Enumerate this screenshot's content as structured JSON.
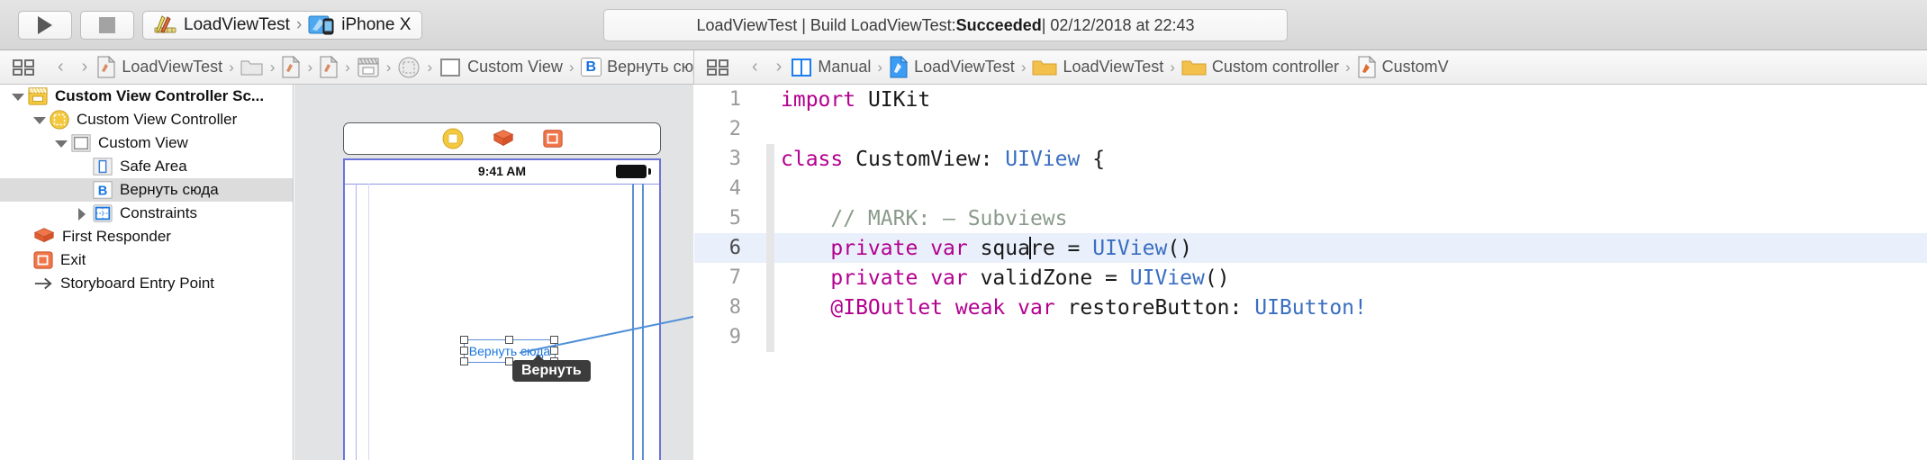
{
  "toolbar": {
    "run_button": "run-button",
    "stop_button": "stop-button",
    "scheme_target": "LoadViewTest",
    "scheme_separator": "›",
    "scheme_device": "iPhone X",
    "status_prefix": "LoadViewTest | Build LoadViewTest: ",
    "status_result": "Succeeded",
    "status_suffix": " | 02/12/2018 at 22:43"
  },
  "jumpbar_left": {
    "items": [
      {
        "icon": "storyboard-file-icon",
        "label": "LoadViewTest"
      },
      {
        "icon": "folder-icon",
        "label": ""
      },
      {
        "icon": "storyboard-file-icon",
        "label": ""
      },
      {
        "icon": "storyboard-file-icon",
        "label": ""
      },
      {
        "icon": "view-controller-scene-icon",
        "label": ""
      },
      {
        "icon": "view-controller-icon",
        "label": ""
      },
      {
        "icon": "view-icon",
        "label": "Custom View"
      },
      {
        "icon": "button-chip-icon",
        "label": "Вернуть сюда"
      }
    ],
    "chip_letter": "B"
  },
  "jumpbar_right": {
    "items": [
      {
        "icon": "assistant-manual-icon",
        "label": "Manual"
      },
      {
        "icon": "swift-project-icon",
        "label": "LoadViewTest"
      },
      {
        "icon": "folder-icon",
        "label": "LoadViewTest"
      },
      {
        "icon": "folder-icon",
        "label": "Custom controller"
      },
      {
        "icon": "swift-file-icon",
        "label": "CustomV"
      }
    ]
  },
  "outline": {
    "rows": [
      {
        "indent": 0,
        "triangle": "down",
        "icon": "scene-icon",
        "label": "Custom View Controller Sc...",
        "bold": true,
        "selected": false
      },
      {
        "indent": 1,
        "triangle": "down",
        "icon": "view-controller-icon",
        "label": "Custom View Controller",
        "bold": false,
        "selected": false
      },
      {
        "indent": 2,
        "triangle": "down",
        "icon": "view-icon",
        "label": "Custom View",
        "bold": false,
        "selected": false
      },
      {
        "indent": 3,
        "triangle": "none",
        "icon": "safe-area-icon",
        "label": "Safe Area",
        "bold": false,
        "selected": false
      },
      {
        "indent": 3,
        "triangle": "none",
        "icon": "button-icon",
        "label": "Вернуть сюда",
        "bold": false,
        "selected": true
      },
      {
        "indent": 2,
        "triangle": "right",
        "icon": "constraints-icon",
        "label": "Constraints",
        "bold": false,
        "selected": false
      },
      {
        "indent": 0,
        "triangle": "none",
        "icon": "first-responder-icon",
        "label": "First Responder",
        "bold": false,
        "selected": false
      },
      {
        "indent": 0,
        "triangle": "none",
        "icon": "exit-icon",
        "label": "Exit",
        "bold": false,
        "selected": false
      },
      {
        "indent": 0,
        "triangle": "none",
        "icon": "entry-point-arrow-icon",
        "label": "Storyboard Entry Point",
        "bold": false,
        "selected": false
      }
    ]
  },
  "canvas": {
    "ib_bar_icons": [
      "view-controller-round-icon",
      "first-responder-cube-icon",
      "exit-square-icon"
    ],
    "phone_status_time": "9:41 AM",
    "selected_button_title": "Вернуть сюда",
    "tooltip_text": "Вернуть"
  },
  "editor": {
    "lines": [
      {
        "num": "1",
        "tokens": [
          {
            "t": "kw",
            "v": "import"
          },
          {
            "t": "pln",
            "v": " UIKit"
          }
        ],
        "highlight": false,
        "fold": false
      },
      {
        "num": "2",
        "tokens": [],
        "highlight": false,
        "fold": false
      },
      {
        "num": "3",
        "tokens": [
          {
            "t": "kw",
            "v": "class"
          },
          {
            "t": "pln",
            "v": " CustomView: "
          },
          {
            "t": "typ",
            "v": "UIView"
          },
          {
            "t": "pln",
            "v": " {"
          }
        ],
        "highlight": false,
        "fold": true
      },
      {
        "num": "4",
        "tokens": [],
        "highlight": false,
        "fold": true
      },
      {
        "num": "5",
        "tokens": [
          {
            "t": "cmt",
            "v": "    // MARK: — Subviews"
          }
        ],
        "highlight": false,
        "fold": true
      },
      {
        "num": "6",
        "tokens": [
          {
            "t": "kw",
            "v": "    private"
          },
          {
            "t": "pln",
            "v": " "
          },
          {
            "t": "kw",
            "v": "var"
          },
          {
            "t": "pln",
            "v": " squa"
          },
          {
            "t": "cursor",
            "v": ""
          },
          {
            "t": "pln",
            "v": "re = "
          },
          {
            "t": "typ",
            "v": "UIView"
          },
          {
            "t": "pln",
            "v": "()"
          }
        ],
        "highlight": true,
        "fold": true
      },
      {
        "num": "7",
        "tokens": [
          {
            "t": "kw",
            "v": "    private"
          },
          {
            "t": "pln",
            "v": " "
          },
          {
            "t": "kw",
            "v": "var"
          },
          {
            "t": "pln",
            "v": " validZone = "
          },
          {
            "t": "typ",
            "v": "UIView"
          },
          {
            "t": "pln",
            "v": "()"
          }
        ],
        "highlight": false,
        "fold": true
      },
      {
        "num": "8",
        "tokens": [
          {
            "t": "kw",
            "v": "    @IBOutlet"
          },
          {
            "t": "pln",
            "v": " "
          },
          {
            "t": "kw",
            "v": "weak"
          },
          {
            "t": "pln",
            "v": " "
          },
          {
            "t": "kw",
            "v": "var"
          },
          {
            "t": "pln",
            "v": " restoreButton: "
          },
          {
            "t": "typ",
            "v": "UIButton!"
          }
        ],
        "highlight": false,
        "fold": true
      },
      {
        "num": "9",
        "tokens": [],
        "highlight": false,
        "fold": true
      }
    ]
  },
  "colors": {
    "keyword": "#b3008f",
    "type": "#3a6ec0",
    "comment": "#8b9b8b",
    "selection": "#dcdcdc",
    "highlight_line": "#e9f0fb",
    "guide_purple": "#6b73d8",
    "guide_blue": "#5c8fd6",
    "folder_yellow": "#f3c04b"
  }
}
